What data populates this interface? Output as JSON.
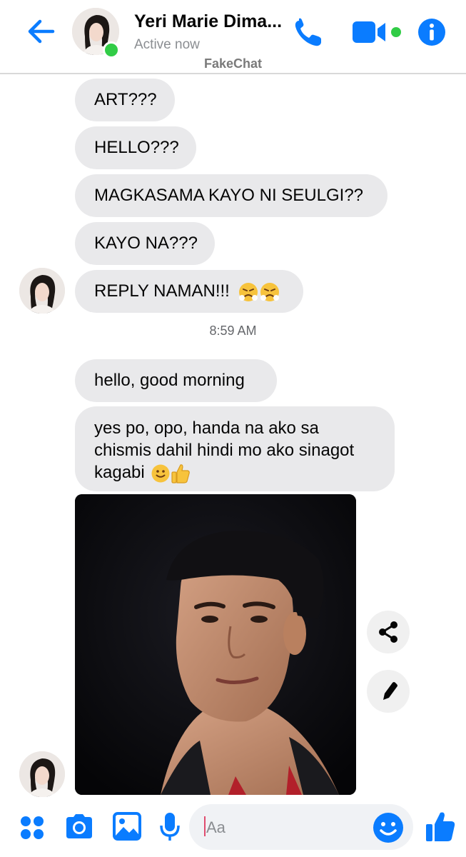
{
  "header": {
    "contact_name": "Yeri Marie Dima...",
    "status": "Active now",
    "watermark": "FakeChat"
  },
  "messages": [
    {
      "text": "ART???"
    },
    {
      "text": "HELLO???"
    },
    {
      "text": "MAGKASAMA KAYO NI SEULGI??"
    },
    {
      "text": "KAYO NA???"
    },
    {
      "text": "REPLY NAMAN!!!",
      "emoji": [
        "angry-face-emoji",
        "angry-face-emoji"
      ]
    },
    {
      "text": "hello, good morning"
    },
    {
      "text": "yes po, opo, handa na ako sa chismis dahil hindi mo ako sinagot kagabi",
      "emoji": [
        "smiling-face-emoji",
        "thumbs-up-emoji"
      ]
    }
  ],
  "timestamp": "8:59 AM",
  "composer": {
    "placeholder": "Aa"
  },
  "icons": {
    "back": "back-arrow-icon",
    "call": "phone-icon",
    "video": "video-camera-icon",
    "info": "info-icon",
    "share": "share-icon",
    "edit": "pencil-icon",
    "more": "grid-dots-icon",
    "camera": "camera-icon",
    "gallery": "image-icon",
    "mic": "microphone-icon",
    "emoji": "emoji-icon",
    "like": "thumbs-up-icon"
  },
  "colors": {
    "accent": "#0a7cff",
    "online": "#31cc46",
    "bubble": "#e9e9eb"
  }
}
